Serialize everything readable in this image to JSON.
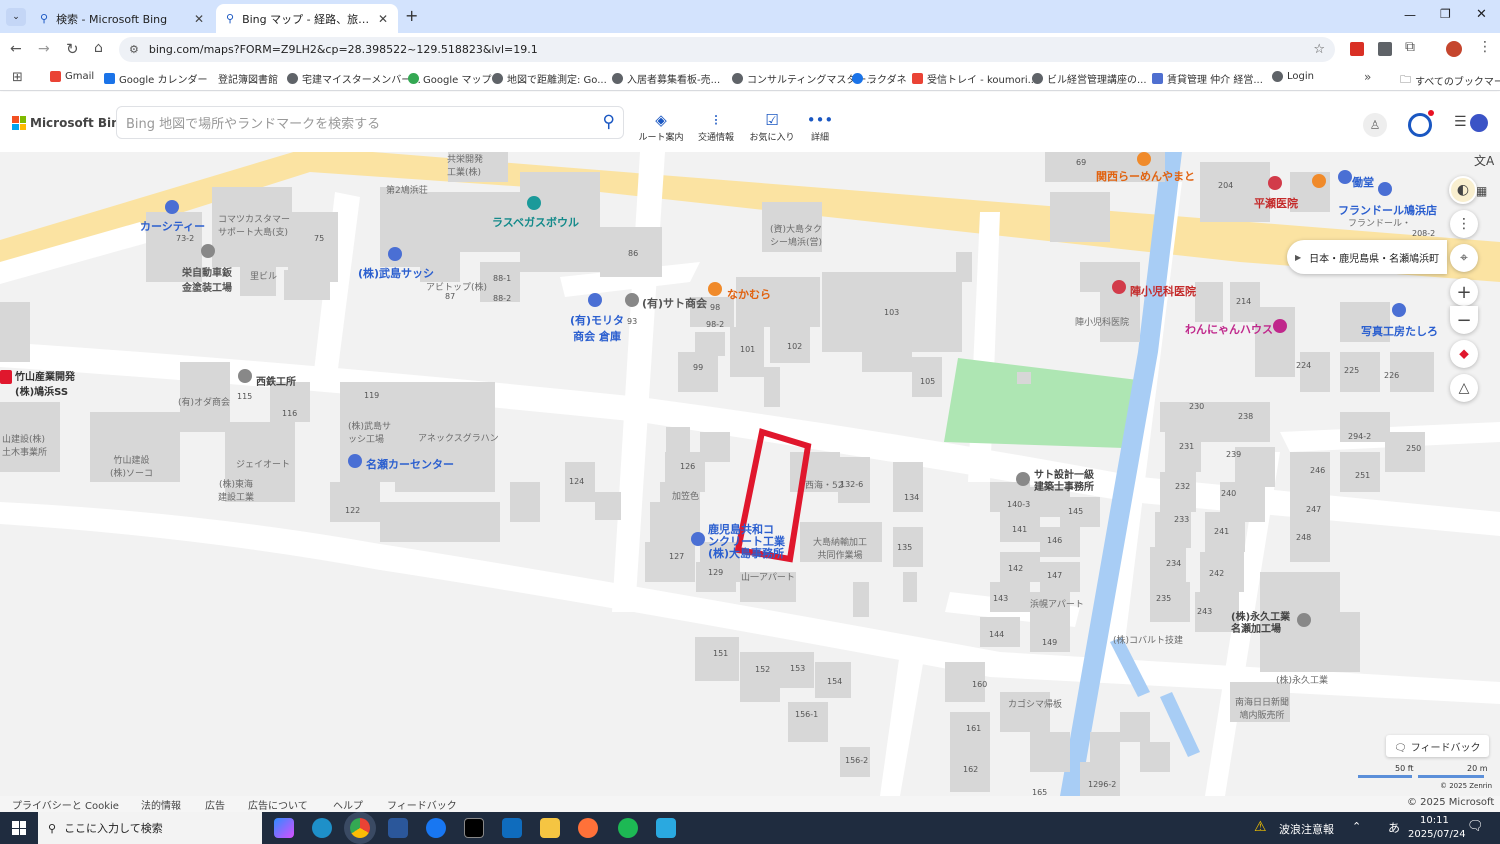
{
  "browser": {
    "tabs": [
      {
        "title": "検索 - Microsoft Bing"
      },
      {
        "title": "Bing マップ - 経路、旅行の計画、"
      }
    ],
    "new_tab_symbol": "+",
    "url": "bing.com/maps?FORM=Z9LH2&cp=28.398522~129.518823&lvl=19.1",
    "bookmarks": [
      "Gmail",
      "Google カレンダー",
      "登記簿図書館",
      "宅建マイスターメンバー...",
      "Google マップ",
      "地図で距離測定: Go...",
      "入居者募集看板-売...",
      "コンサルティングマスター...",
      "ラクダネ",
      "受信トレイ - koumori...",
      "ビル経営管理講座の...",
      "賃貸管理 仲介 経営...",
      "Login"
    ],
    "all_bookmarks": "すべてのブックマーク"
  },
  "bing": {
    "logo": "Microsoft Bing",
    "search_placeholder": "Bing 地図で場所やランドマークを検索する",
    "tools": [
      "ルート案内",
      "交通情報",
      "お気に入り",
      "詳細"
    ]
  },
  "map": {
    "location_breadcrumb": "日本・鹿児島県・名瀬鳩浜町",
    "labels": {
      "kansai": "関西らーめんやまと",
      "hirase": "平瀬医院",
      "hataraki": "働堂",
      "fleurdoll": "フランドール鳩浜店",
      "fleurdoll2": "フランドール・",
      "carcity": "カーシティー",
      "komatsu": "コマツカスタマー\nサポート大島(支)",
      "eiji": "栄自動車鈑\n金塗装工場",
      "sanpo": "(株)武島サッシ",
      "lasvegas": "ラスベガスボウル",
      "kyoei": "共栄開発\n工業(株)",
      "kyoei2": "第2鳩浜荘",
      "sato": "(有)サト商会",
      "morita": "(有)モリタ\n商会 倉庫",
      "nakamura": "なかむら",
      "jin": "陣小児科医院",
      "jin2": "陣小児科医院",
      "wanya": "わんにゃんハウス",
      "shashin": "写真工房たしろ",
      "takeyama": "竹山産業開発\n(株)鳩浜SS",
      "nishitetsu": "西鉄工所",
      "oda": "(有)オダ商会",
      "nazecar": "名瀬カーセンター",
      "annex": "アネックスグラハン",
      "kashima": "鹿児島共和コ\nンクリート工業\n(株)大島事務所",
      "satosekkei": "サト設計一級\n建築士事務所",
      "hisashi": "(株)永久工業\n名瀬加工場",
      "cobalt": "(株)コバルト技建",
      "hisashi2": "(株)永久工業",
      "nankai": "南海日日新聞\n鳩内販売所",
      "yamaapart": "山一アパート",
      "taishima": "大島納輸加工\n共同作業場",
      "kagoshima_daikoku": "カゴシマ帰板",
      "hamaura": "浜幌アパート",
      "jayot": "ジェイオート",
      "tokai": "(株)東海\n建設工業",
      "somagane": "竹山建設\n(株)ソーコ",
      "kanagun": "山建設(株)\n土木事業所",
      "takemura": "(株)武島サ\nッシ工場",
      "abitopp": "アビトップ(株)",
      "kake": "加笠色",
      "taijima": "(資)大島タク\nシー鳩浜(営)",
      "satoshi": "里ビル",
      "nishitei": "西海・52"
    },
    "numbers": [
      "69",
      "204",
      "208-2",
      "86",
      "75",
      "73-2",
      "88-1",
      "88-2",
      "87",
      "98",
      "98-2",
      "93",
      "101",
      "102",
      "99",
      "103",
      "105",
      "214",
      "224",
      "225",
      "226",
      "230",
      "238",
      "119",
      "115",
      "116",
      "126",
      "124",
      "122",
      "132-6",
      "134",
      "135",
      "127",
      "129",
      "140-3",
      "145",
      "141",
      "146",
      "142",
      "147",
      "143",
      "144",
      "149",
      "231",
      "239",
      "246",
      "251",
      "250",
      "294-2",
      "232",
      "240",
      "247",
      "233",
      "241",
      "248",
      "234",
      "242",
      "235",
      "243",
      "151",
      "152",
      "153",
      "154",
      "156-1",
      "156-2",
      "160",
      "161",
      "162",
      "165",
      "1296-2"
    ],
    "scale": {
      "ft": "50 ft",
      "m": "20 m"
    },
    "copyright_zenrin": "© 2025 Zenrin",
    "feedback": "フィードバック"
  },
  "footer": {
    "links": [
      "プライバシーと Cookie",
      "法的情報",
      "広告",
      "広告について",
      "ヘルプ",
      "フィードバック"
    ],
    "copyright": "© 2025 Microsoft"
  },
  "taskbar": {
    "search_placeholder": "ここに入力して検索",
    "weather": "波浪注意報",
    "ime": "あ",
    "time": "10:11",
    "date": "2025/07/24"
  },
  "colors": {
    "tabbar": "#d3e3fd",
    "highway": "#fbe3a2",
    "park": "#aee6b3",
    "river": "#a8cdf5",
    "highlight": "#e0172d",
    "building": "#d7d7d7",
    "taskbar": "#1f2c3f"
  }
}
